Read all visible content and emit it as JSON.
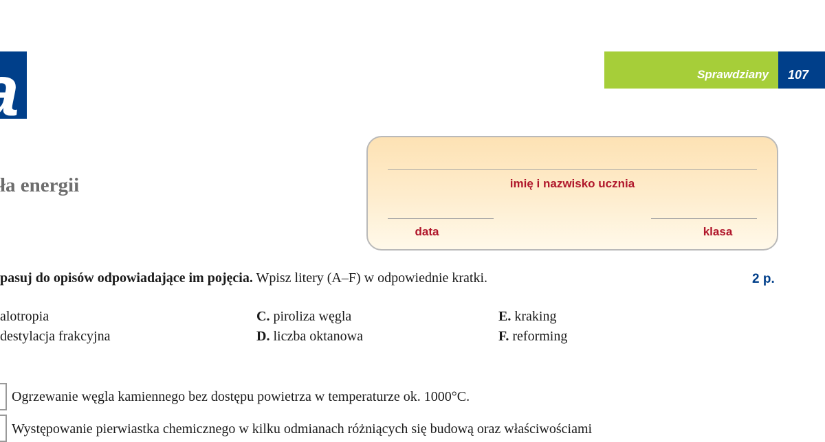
{
  "logo": {
    "glyph": "a"
  },
  "header": {
    "section_label": "Sprawdziany",
    "page_number": "107"
  },
  "section_title": "ła energii",
  "student_box": {
    "name_label": "imię i nazwisko ucznia",
    "date_label": "data",
    "class_label": "klasa"
  },
  "task": {
    "instruction_bold": "pasuj do opisów odpowiadające im pojęcia.",
    "instruction_rest": " Wpisz litery (A–F) w odpowiednie kratki.",
    "points": "2 p."
  },
  "options": [
    {
      "letter": "",
      "text": "alotropia"
    },
    {
      "letter": "",
      "text": "destylacja frakcyjna"
    },
    {
      "letter": "C.",
      "text": " piroliza węgla"
    },
    {
      "letter": "D.",
      "text": " liczba oktanowa"
    },
    {
      "letter": "E.",
      "text": " kraking"
    },
    {
      "letter": "F.",
      "text": "  reforming"
    }
  ],
  "descriptions": [
    {
      "text": "Ogrzewanie węgla kamiennego bez dostępu powietrza w temperaturze ok. 1000°C."
    },
    {
      "text": "Występowanie pierwiastka chemicznego w kilku odmianach różniących się budową oraz właściwościami"
    }
  ]
}
